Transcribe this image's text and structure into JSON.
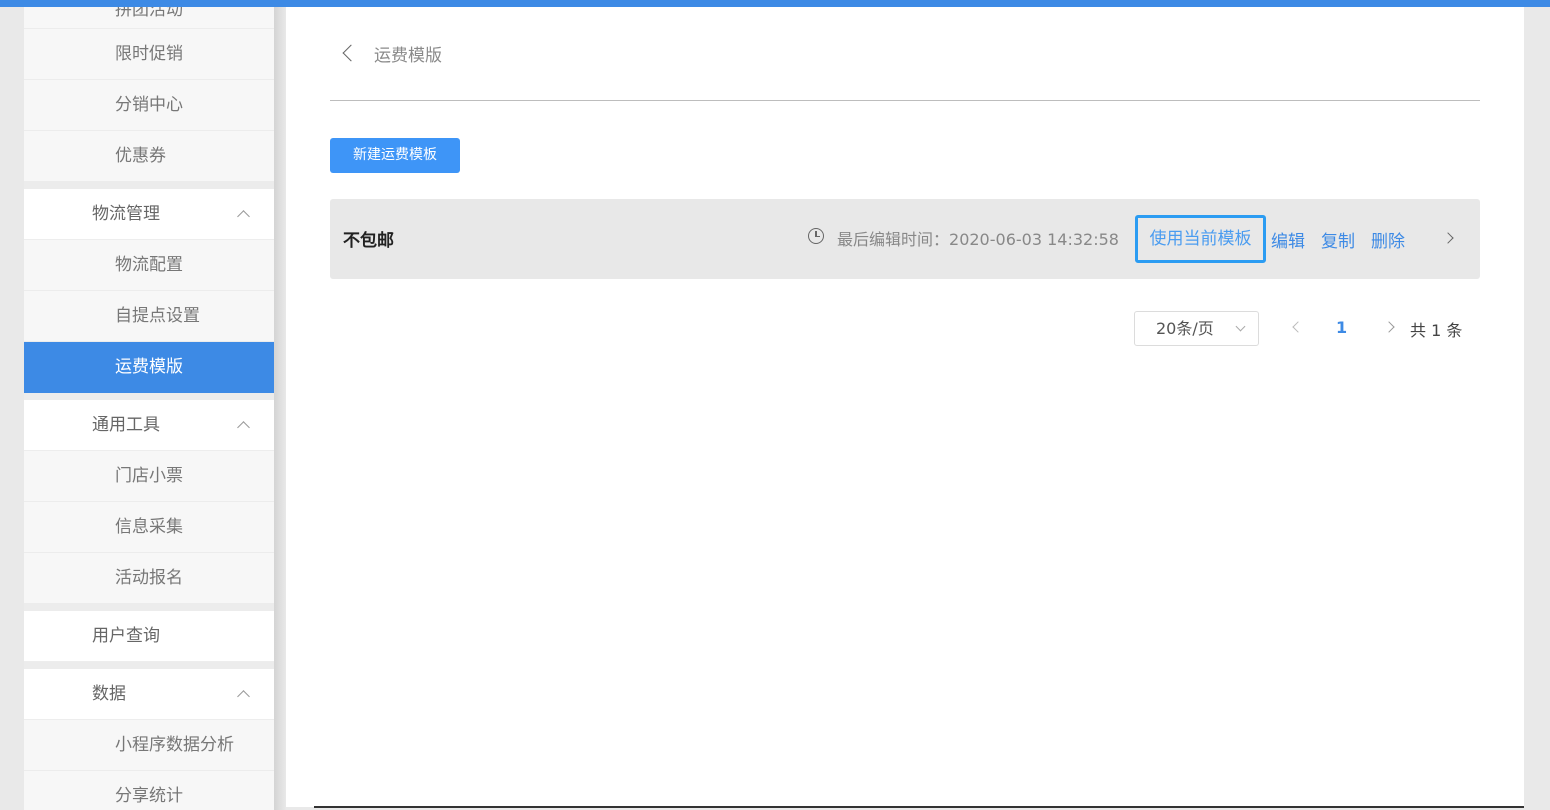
{
  "sidebar": {
    "cut_top_label": "拼团活动",
    "items_before": [
      {
        "label": "限时促销"
      },
      {
        "label": "分销中心"
      },
      {
        "label": "优惠券"
      }
    ],
    "group_logistics": {
      "label": "物流管理",
      "items": [
        {
          "label": "物流配置"
        },
        {
          "label": "自提点设置"
        },
        {
          "label": "运费模版"
        }
      ]
    },
    "group_tools": {
      "label": "通用工具",
      "items": [
        {
          "label": "门店小票"
        },
        {
          "label": "信息采集"
        },
        {
          "label": "活动报名"
        }
      ]
    },
    "user_query": {
      "label": "用户查询"
    },
    "group_data": {
      "label": "数据",
      "items": [
        {
          "label": "小程序数据分析"
        },
        {
          "label": "分享统计"
        }
      ]
    }
  },
  "header": {
    "breadcrumb": "运费模版"
  },
  "toolbar": {
    "new_button": "新建运费模板"
  },
  "template_row": {
    "name": "不包邮",
    "last_edit_label": "最后编辑时间：",
    "last_edit_value": "2020-06-03 14:32:58",
    "use_button": "使用当前模板",
    "edit": "编辑",
    "copy": "复制",
    "delete": "删除"
  },
  "pagination": {
    "page_size": "20条/页",
    "current_page": "1",
    "total": "共 1 条"
  },
  "colors": {
    "accent": "#3d8ae5",
    "button": "#3e95f7",
    "highlight_border": "#2b9cf2"
  }
}
